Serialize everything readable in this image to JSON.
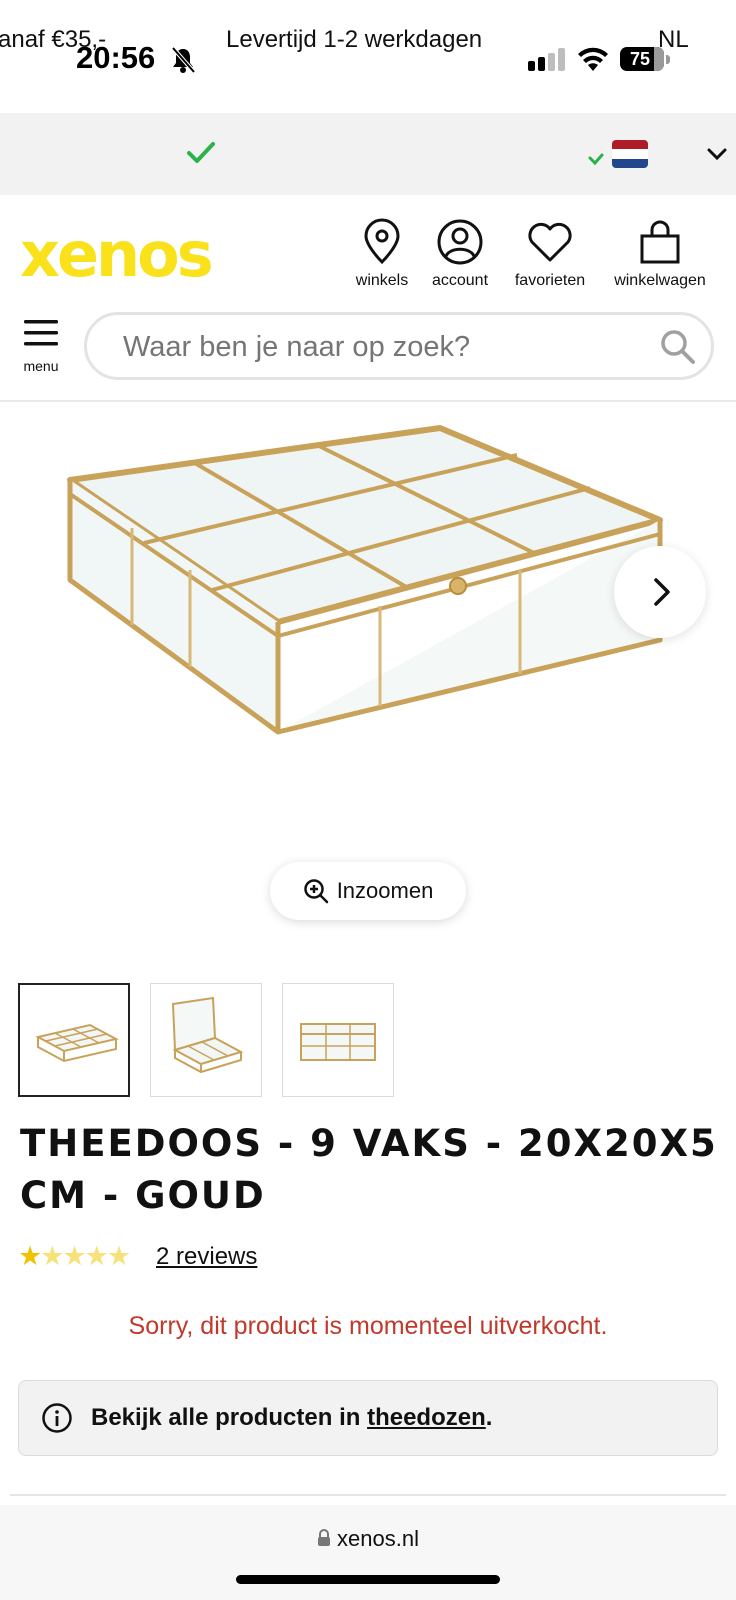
{
  "status_bar": {
    "time": "20:56",
    "battery": "75"
  },
  "promo": {
    "left_text": "anaf €35,-",
    "center_text": "Levertijd 1-2 werkdagen",
    "country": "NL",
    "check_color": "#2bb34a"
  },
  "header": {
    "logo": "xenos",
    "brand_color": "#f9e11b",
    "items": [
      {
        "label": "winkels",
        "icon": "location-pin-icon"
      },
      {
        "label": "account",
        "icon": "user-icon"
      },
      {
        "label": "favorieten",
        "icon": "heart-icon"
      },
      {
        "label": "winkelwagen",
        "icon": "shopping-bag-icon"
      }
    ],
    "menu_label": "menu"
  },
  "search": {
    "placeholder": "Waar ben je naar op zoek?"
  },
  "gallery": {
    "zoom_label": "Inzoomen",
    "thumbnail_count": 3,
    "active_thumbnail": 1
  },
  "product": {
    "title": "Theedoos - 9 vaks - 20x20x5 cm - goud",
    "rating": 1,
    "rating_max": 5,
    "reviews_label": "2 reviews",
    "soldout_text": "Sorry, dit product is momenteel uitverkocht.",
    "soldout_color": "#c0392b",
    "info_prefix": "Bekijk alle producten in ",
    "info_link": "theedozen",
    "info_suffix": "."
  },
  "browser": {
    "url": "xenos.nl"
  }
}
